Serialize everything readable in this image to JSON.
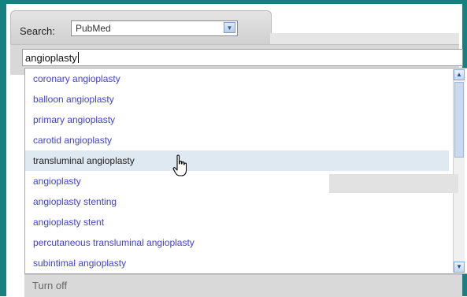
{
  "search": {
    "label": "Search:",
    "database": "PubMed",
    "query": "angioplasty"
  },
  "suggestions": {
    "items": [
      "coronary angioplasty",
      "balloon angioplasty",
      "primary angioplasty",
      "carotid angioplasty",
      "transluminal angioplasty",
      "angioplasty",
      "angioplasty stenting",
      "angioplasty stent",
      "percutaneous transluminal angioplasty",
      "subintimal angioplasty"
    ],
    "active_index": 4,
    "turn_off_label": "Turn off"
  },
  "colors": {
    "frame": "#1a7f80",
    "suggestion_link": "#4040d8",
    "active_row": "#dfe9f2"
  },
  "icons": {
    "cursor": "hand-pointer-icon",
    "dropdown": "chevron-down-icon"
  }
}
